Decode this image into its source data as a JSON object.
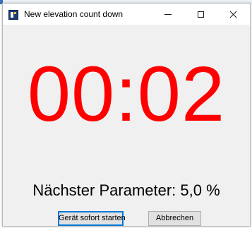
{
  "window": {
    "title": "New elevation count down",
    "controls": {
      "minimize": "minimize",
      "maximize": "maximize",
      "close": "close"
    }
  },
  "countdown": {
    "time": "00:02",
    "color": "#ff0000"
  },
  "next_parameter": {
    "text": "Nächster Parameter: 5,0 %"
  },
  "buttons": {
    "start_now_label": "Gerät sofort starten",
    "cancel_label": "Abbrechen"
  },
  "icons": {
    "app": "app-icon",
    "minimize": "minimize-icon",
    "maximize": "maximize-icon",
    "close": "close-icon"
  },
  "colors": {
    "window_bg": "#f0f0f0",
    "titlebar_bg": "#ffffff",
    "focus_border": "#0078d7"
  }
}
